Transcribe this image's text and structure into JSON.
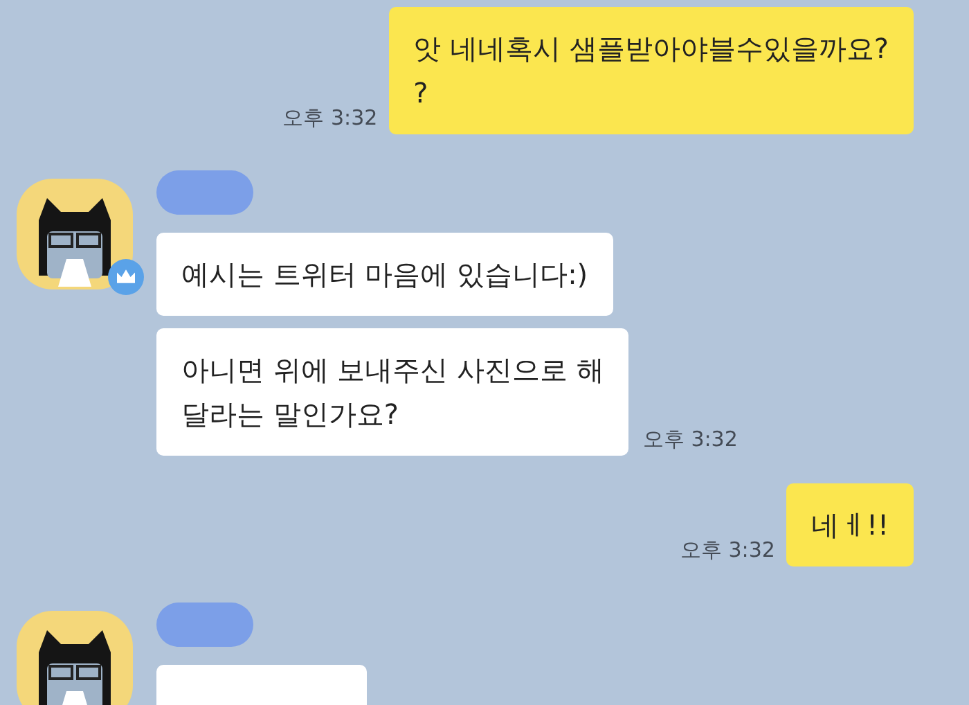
{
  "messages": [
    {
      "kind": "sent",
      "lines": [
        "앗 네네혹시 샘플받아야블수있을까요?",
        "?"
      ],
      "time": "오후 3:32"
    },
    {
      "kind": "received",
      "badge": true,
      "cut_off": false,
      "bubbles": [
        {
          "lines": [
            "예시는 트위터 마음에 있습니다:)"
          ]
        },
        {
          "lines": [
            "아니면 위에 보내주신 사진으로 해",
            "달라는 말인가요?"
          ],
          "time": "오후 3:32"
        }
      ]
    },
    {
      "kind": "sent",
      "lines": [
        "네ㅔ!!"
      ],
      "time": "오후 3:32"
    },
    {
      "kind": "received",
      "badge": false,
      "cut_off": true
    }
  ]
}
